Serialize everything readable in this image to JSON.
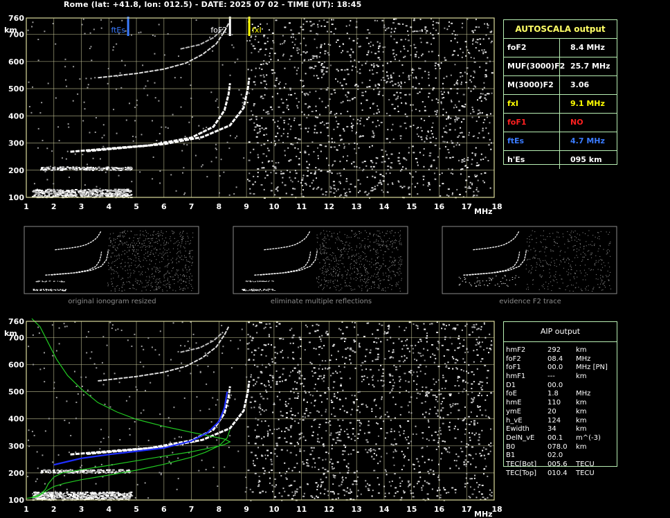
{
  "header": "Rome (lat: +41.8, lon: 012.5) - DATE: 2025 07 02 - TIME (UT): 18:45",
  "colors": {
    "grid": "#c8c89a",
    "frame": "#dcdc9c",
    "panel_border": "#b9f0b4",
    "fxI": "#ffff00",
    "ftEs": "#3a7bff",
    "foF1": "#ff2020",
    "profile": "#22cc22",
    "trace": "#1f2fff"
  },
  "chart_data": [
    {
      "type": "scatter",
      "xlim": [
        1,
        18
      ],
      "ylim": [
        100,
        760
      ],
      "xticks": [
        "1",
        "2",
        "3",
        "4",
        "5",
        "6",
        "7",
        "8",
        "9",
        "10",
        "11",
        "12",
        "13",
        "14",
        "15",
        "16",
        "17",
        "18"
      ],
      "yticks": [
        "100",
        "200",
        "300",
        "400",
        "500",
        "600",
        "700",
        "760"
      ],
      "xlabel": "MHz",
      "ylabel": "km",
      "markers": [
        {
          "label": "ftEs",
          "x": 4.7
        },
        {
          "label": "foF2",
          "x": 8.4
        },
        {
          "label": "fxI",
          "x": 9.1
        }
      ],
      "traces": {
        "o": [
          [
            2.6,
            268
          ],
          [
            4.0,
            280
          ],
          [
            5.5,
            292
          ],
          [
            7.0,
            320
          ],
          [
            7.8,
            360
          ],
          [
            8.2,
            420
          ],
          [
            8.35,
            480
          ],
          [
            8.4,
            520
          ]
        ],
        "x": [
          [
            3.2,
            270
          ],
          [
            4.5,
            282
          ],
          [
            6.0,
            296
          ],
          [
            7.4,
            322
          ],
          [
            8.4,
            365
          ],
          [
            8.9,
            430
          ],
          [
            9.05,
            500
          ],
          [
            9.1,
            540
          ]
        ],
        "o2": [
          [
            3.6,
            540
          ],
          [
            5.0,
            556
          ],
          [
            6.0,
            572
          ],
          [
            6.8,
            594
          ],
          [
            7.4,
            626
          ],
          [
            7.9,
            665
          ],
          [
            8.2,
            710
          ],
          [
            8.35,
            740
          ]
        ],
        "o2x": [
          [
            6.6,
            646
          ],
          [
            7.3,
            662
          ],
          [
            7.8,
            688
          ],
          [
            8.15,
            720
          ]
        ]
      }
    },
    {
      "type": "line",
      "xlim": [
        1,
        18
      ],
      "ylim": [
        100,
        760
      ],
      "xlabel": "MHz",
      "ylabel": "km",
      "series": [
        {
          "points": [
            [
              1.2,
              110
            ],
            [
              1.5,
              120
            ],
            [
              1.7,
              140
            ],
            [
              1.8,
              160
            ],
            [
              2.0,
              185
            ],
            [
              2.3,
              200
            ],
            [
              3.0,
              212
            ],
            [
              4.0,
              228
            ],
            [
              5.0,
              245
            ],
            [
              6.0,
              262
            ],
            [
              7.0,
              278
            ],
            [
              7.8,
              295
            ],
            [
              8.2,
              305
            ],
            [
              8.4,
              315
            ],
            [
              8.2,
              325
            ],
            [
              7.6,
              338
            ],
            [
              7.0,
              350
            ],
            [
              6.0,
              372
            ],
            [
              5.0,
              398
            ],
            [
              4.3,
              425
            ],
            [
              3.6,
              460
            ],
            [
              3.0,
              510
            ],
            [
              2.5,
              560
            ],
            [
              2.1,
              620
            ],
            [
              1.8,
              680
            ],
            [
              1.5,
              740
            ],
            [
              1.2,
              770
            ]
          ]
        },
        {
          "points": [
            [
              1.0,
              106
            ],
            [
              1.4,
              112
            ],
            [
              1.6,
              125
            ],
            [
              1.8,
              138
            ],
            [
              2.0,
              150
            ],
            [
              2.4,
              162
            ],
            [
              3.0,
              175
            ],
            [
              4.0,
              192
            ],
            [
              5.0,
              210
            ],
            [
              6.0,
              232
            ],
            [
              7.0,
              258
            ],
            [
              7.5,
              276
            ],
            [
              8.0,
              300
            ],
            [
              8.3,
              330
            ],
            [
              8.4,
              360
            ]
          ]
        },
        {
          "points": [
            [
              2.0,
              230
            ],
            [
              2.5,
              242
            ],
            [
              3.0,
              254
            ],
            [
              4.0,
              268
            ],
            [
              5.0,
              280
            ],
            [
              6.0,
              292
            ],
            [
              7.0,
              318
            ],
            [
              7.6,
              350
            ],
            [
              8.0,
              390
            ],
            [
              8.2,
              440
            ],
            [
              8.3,
              500
            ]
          ]
        }
      ]
    }
  ],
  "autoscala": {
    "title": "AUTOSCALA output",
    "rows": [
      {
        "label": "foF2",
        "value": "8.4 MHz",
        "color": "#ffffff"
      },
      {
        "label": "MUF(3000)F2",
        "value": "25.7 MHz",
        "color": "#ffffff"
      },
      {
        "label": "M(3000)F2",
        "value": "3.06",
        "color": "#ffffff"
      },
      {
        "label": "fxI",
        "value": "9.1 MHz",
        "color": "#ffff00"
      },
      {
        "label": "foF1",
        "value": "NO",
        "color": "#ff2020"
      },
      {
        "label": "ftEs",
        "value": "4.7 MHz",
        "color": "#3a7bff"
      },
      {
        "label": "h'Es",
        "value": "095    km",
        "color": "#ffffff"
      }
    ]
  },
  "thumbnails": [
    {
      "caption": "original ionogram resized"
    },
    {
      "caption": "eliminate multiple reflections"
    },
    {
      "caption": "evidence F2 trace"
    }
  ],
  "aip": {
    "title": "AIP output",
    "rows": [
      {
        "name": "hmF2",
        "value": "292",
        "unit": "km"
      },
      {
        "name": "foF2",
        "value": "08.4",
        "unit": "MHz"
      },
      {
        "name": "foF1",
        "value": "00.0",
        "unit": "MHz    [PN]"
      },
      {
        "name": "hmF1",
        "value": "---",
        "unit": "km"
      },
      {
        "name": "D1",
        "value": "00.0",
        "unit": ""
      },
      {
        "name": "foE",
        "value": "1.8",
        "unit": "MHz"
      },
      {
        "name": "hmE",
        "value": "110",
        "unit": "km"
      },
      {
        "name": "ymE",
        "value": "20",
        "unit": "km"
      },
      {
        "name": "h_vE",
        "value": "124",
        "unit": "km"
      },
      {
        "name": "Ewidth",
        "value": "34",
        "unit": "km"
      },
      {
        "name": "DelN_vE",
        "value": "00.1",
        "unit": "m^(-3)"
      },
      {
        "name": "B0",
        "value": "078.0",
        "unit": "km"
      },
      {
        "name": "B1",
        "value": "02.0",
        "unit": ""
      },
      {
        "name": "TEC[Bot]",
        "value": "005.6",
        "unit": "TECU"
      },
      {
        "name": "TEC[Top]",
        "value": "010.4",
        "unit": "TECU"
      }
    ]
  }
}
